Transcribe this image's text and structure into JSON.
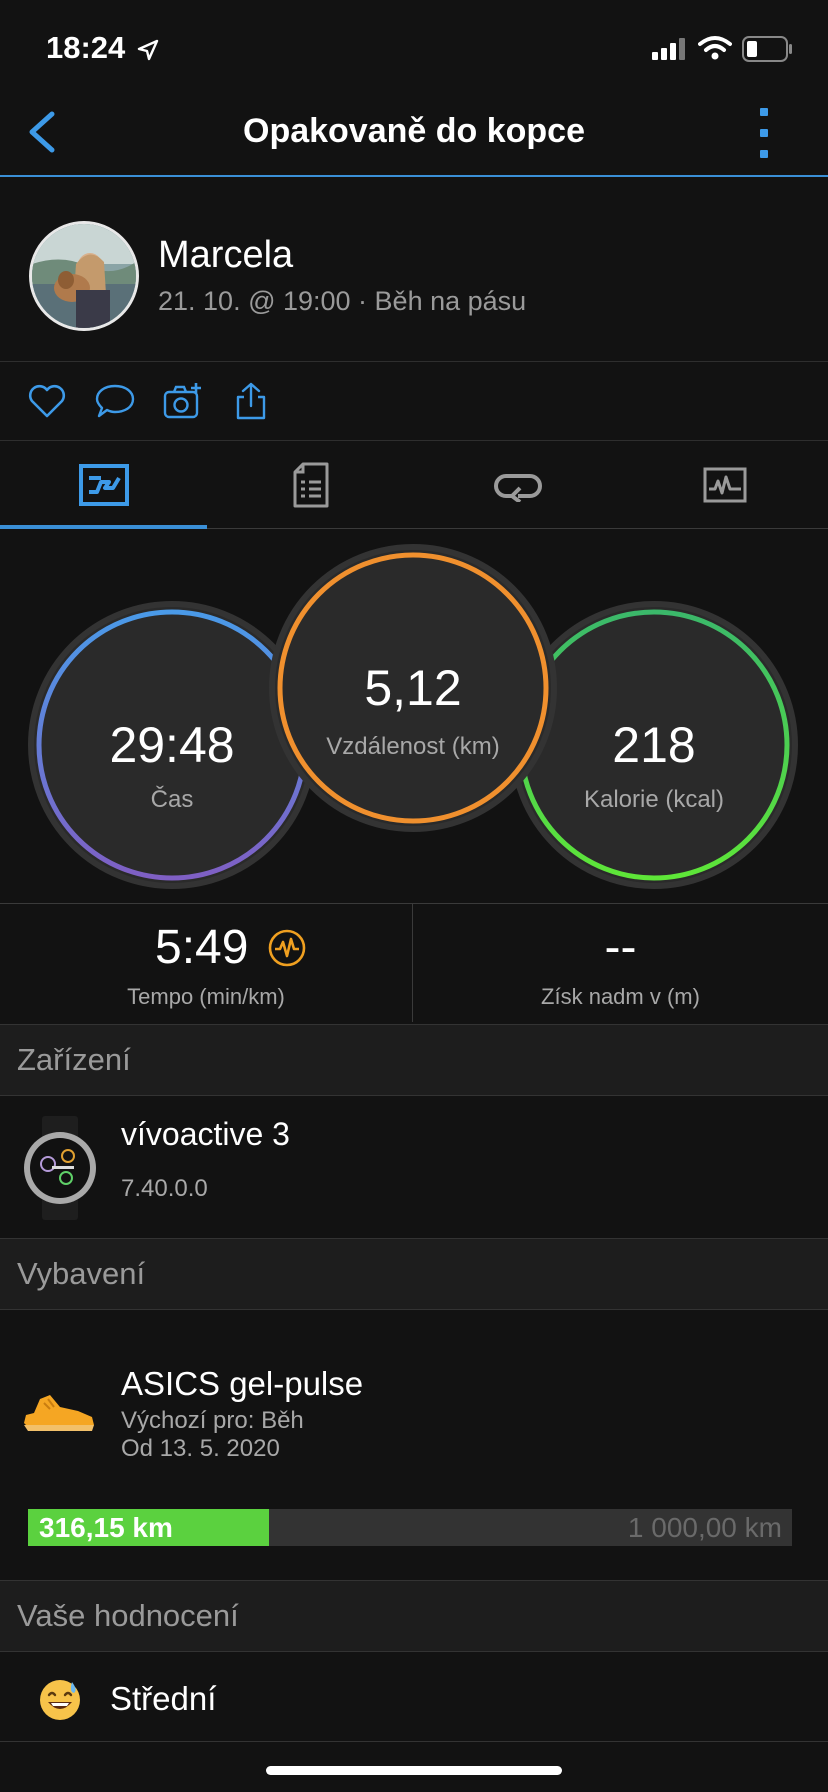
{
  "status_bar": {
    "time": "18:24",
    "icons": [
      "location-arrow-icon",
      "signal-icon",
      "wifi-icon",
      "battery-icon"
    ]
  },
  "nav": {
    "title": "Opakovaně do kopce",
    "back_icon": "chevron-left-icon",
    "menu_icon": "more-vertical-icon"
  },
  "user": {
    "name": "Marcela",
    "meta": "21. 10. @ 19:00 · Běh na pásu"
  },
  "actions": [
    "heart-icon",
    "comment-icon",
    "add-photo-icon",
    "share-icon"
  ],
  "tabs": [
    {
      "icon": "overview-icon",
      "selected": true
    },
    {
      "icon": "details-icon",
      "selected": false
    },
    {
      "icon": "laps-icon",
      "selected": false
    },
    {
      "icon": "charts-icon",
      "selected": false
    }
  ],
  "stats": {
    "time": {
      "value": "29:48",
      "label": "Čas"
    },
    "distance": {
      "value": "5,12",
      "label": "Vzdálenost (km)"
    },
    "calories": {
      "value": "218",
      "label": "Kalorie (kcal)"
    }
  },
  "metrics": {
    "pace": {
      "value": "5:49",
      "label": "Tempo (min/km)"
    },
    "elevation": {
      "value": "--",
      "label": "Získ nadm v (m)"
    }
  },
  "sections": {
    "device": "Zařízení",
    "gear": "Vybavení",
    "rating": "Vaše hodnocení"
  },
  "device": {
    "name": "vívoactive 3",
    "version": "7.40.0.0"
  },
  "gear": {
    "name": "ASICS gel-pulse",
    "default_for": "Výchozí pro: Běh",
    "since": "Od 13. 5. 2020",
    "distance": "316,15 km",
    "max": "1 000,00 km",
    "progress_fraction": 0.316
  },
  "rating": {
    "label": "Střední"
  },
  "colors": {
    "accent": "#3a8fd6",
    "distance_ring": "#f0902e",
    "progress": "#5bd13f"
  }
}
